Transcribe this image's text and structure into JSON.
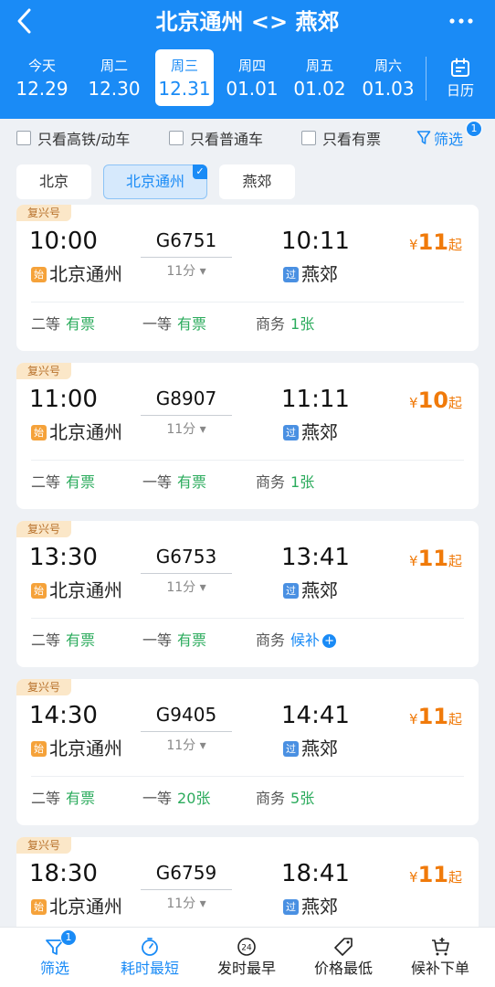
{
  "header": {
    "title": "北京通州 <> 燕郊",
    "back_icon": "back-chevron-icon",
    "more_icon": "more-dots-icon"
  },
  "date_tabs": [
    {
      "weekday": "今天",
      "date": "12.29"
    },
    {
      "weekday": "周二",
      "date": "12.30"
    },
    {
      "weekday": "周三",
      "date": "12.31"
    },
    {
      "weekday": "周四",
      "date": "01.01"
    },
    {
      "weekday": "周五",
      "date": "01.02"
    },
    {
      "weekday": "周六",
      "date": "01.03"
    }
  ],
  "selected_date_index": 2,
  "calendar": {
    "label": "日历",
    "icon": "calendar-icon"
  },
  "filters": {
    "high_speed_only": "只看高铁/动车",
    "regular_only": "只看普通车",
    "available_only": "只看有票",
    "filter_label": "筛选",
    "filter_badge": "1"
  },
  "stations": [
    {
      "label": "北京"
    },
    {
      "label": "北京通州"
    },
    {
      "label": "燕郊"
    }
  ],
  "selected_station_index": 1,
  "trains": [
    {
      "tag": "复兴号",
      "dep": "10:00",
      "arr": "10:11",
      "no": "G6751",
      "dur": "11分",
      "price": "11",
      "price_prefix": "¥",
      "price_suffix": "起",
      "from_mark": "始",
      "from": "北京通州",
      "to_mark": "过",
      "to": "燕郊",
      "s2": "二等",
      "s2v": "有票",
      "s1": "一等",
      "s1v": "有票",
      "sb": "商务",
      "sbv": "1张"
    },
    {
      "tag": "复兴号",
      "dep": "11:00",
      "arr": "11:11",
      "no": "G8907",
      "dur": "11分",
      "price": "10",
      "price_prefix": "¥",
      "price_suffix": "起",
      "from_mark": "始",
      "from": "北京通州",
      "to_mark": "过",
      "to": "燕郊",
      "s2": "二等",
      "s2v": "有票",
      "s1": "一等",
      "s1v": "有票",
      "sb": "商务",
      "sbv": "1张"
    },
    {
      "tag": "复兴号",
      "dep": "13:30",
      "arr": "13:41",
      "no": "G6753",
      "dur": "11分",
      "price": "11",
      "price_prefix": "¥",
      "price_suffix": "起",
      "from_mark": "始",
      "from": "北京通州",
      "to_mark": "过",
      "to": "燕郊",
      "s2": "二等",
      "s2v": "有票",
      "s1": "一等",
      "s1v": "有票",
      "sb": "商务",
      "sbv": "候补"
    },
    {
      "tag": "复兴号",
      "dep": "14:30",
      "arr": "14:41",
      "no": "G9405",
      "dur": "11分",
      "price": "11",
      "price_prefix": "¥",
      "price_suffix": "起",
      "from_mark": "始",
      "from": "北京通州",
      "to_mark": "过",
      "to": "燕郊",
      "s2": "二等",
      "s2v": "有票",
      "s1": "一等",
      "s1v": "20张",
      "sb": "商务",
      "sbv": "5张"
    },
    {
      "tag": "复兴号",
      "dep": "18:30",
      "arr": "18:41",
      "no": "G6759",
      "dur": "11分",
      "price": "11",
      "price_prefix": "¥",
      "price_suffix": "起",
      "from_mark": "始",
      "from": "北京通州",
      "to_mark": "过",
      "to": "燕郊"
    }
  ],
  "bottom_bar": {
    "filter": "筛选",
    "filter_badge": "1",
    "shortest": "耗时最短",
    "earliest": "发时最早",
    "earliest_icon_text": "24",
    "cheapest": "价格最低",
    "waitlist": "候补下单"
  },
  "colors": {
    "brand": "#1a8bf6",
    "price": "#f07a0a",
    "available": "#2bab5c",
    "tag_bg": "#fbe7c8"
  }
}
